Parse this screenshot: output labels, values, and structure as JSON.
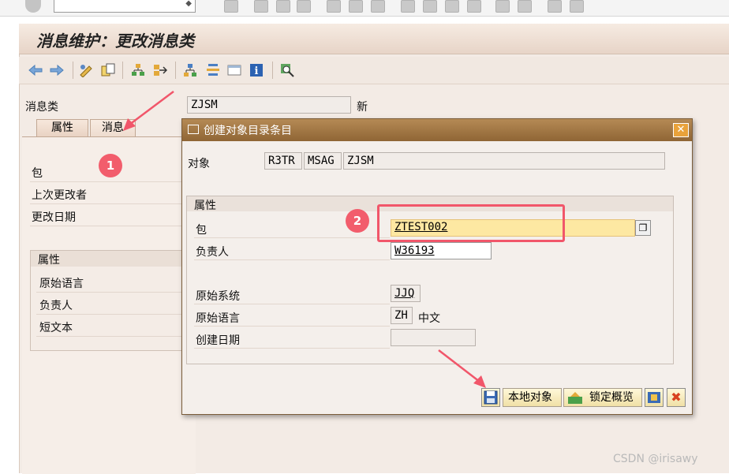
{
  "page": {
    "title": "消息维护：更改消息类",
    "msgclass_label": "消息类",
    "msgclass_value": "ZJSM",
    "msgclass_status": "新"
  },
  "tabs": [
    {
      "label": "属性"
    },
    {
      "label": "消息"
    }
  ],
  "left_panel": {
    "fields": [
      "包",
      "上次更改者",
      "更改日期"
    ],
    "group_title": "属性",
    "group_fields": [
      "原始语言",
      "负责人",
      "短文本"
    ]
  },
  "badges": {
    "one": "1",
    "two": "2"
  },
  "dialog": {
    "title": "创建对象目录条目",
    "object_label": "对象",
    "object_values": [
      "R3TR",
      "MSAG",
      "ZJSM"
    ],
    "group_title": "属性",
    "package_label": "包",
    "package_value": "ZTEST002",
    "owner_label": "负责人",
    "owner_value": "W36193",
    "orig_system_label": "原始系统",
    "orig_system_value": "JJQ",
    "orig_lang_label": "原始语言",
    "orig_lang_value": "ZH",
    "orig_lang_text": "中文",
    "created_label": "创建日期",
    "created_value": "",
    "buttons": {
      "local_object": "本地对象",
      "lock_overview": "锁定概览"
    }
  },
  "watermark": "CSDN @irisawy",
  "colors": {
    "dialog_title": "#9b7040",
    "highlight": "#f1566a",
    "package_field": "#fde8a2"
  }
}
